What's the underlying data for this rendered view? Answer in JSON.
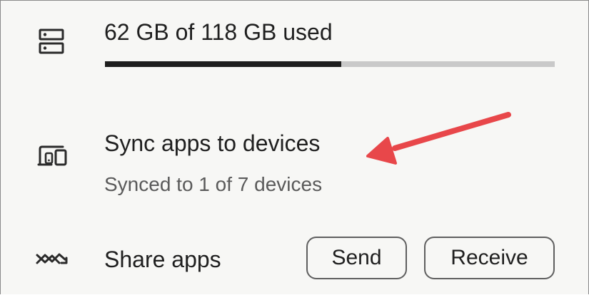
{
  "storage": {
    "icon": "storage-icon",
    "label": "62 GB of 118 GB used",
    "used_fraction": 0.5254
  },
  "sync": {
    "icon": "devices-icon",
    "title": "Sync apps to devices",
    "subtitle": "Synced to 1 of 7 devices"
  },
  "share": {
    "icon": "share-swap-icon",
    "label": "Share apps",
    "send_label": "Send",
    "receive_label": "Receive"
  },
  "annotation": {
    "icon": "red-arrow-icon",
    "color": "#e8474a"
  },
  "colors": {
    "background": "#f7f7f5",
    "progress_fill": "#1e1e1e",
    "progress_track": "#c9c9c9",
    "subtitle": "#5a5a5a"
  }
}
